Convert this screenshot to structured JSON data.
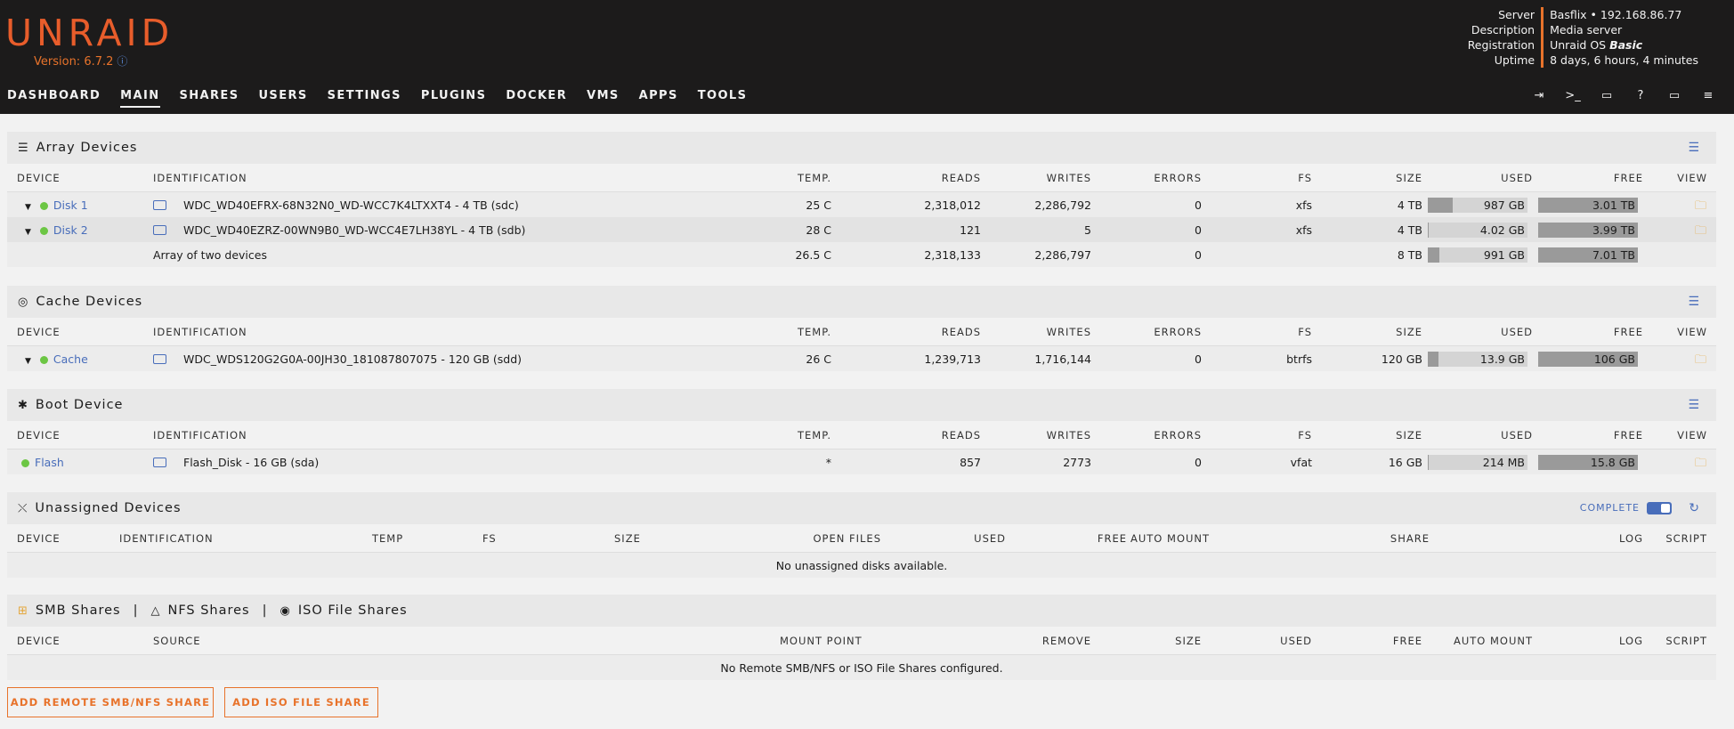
{
  "brand": {
    "logo": "UNRAID",
    "version": "Version: 6.7.2",
    "info_icon": "ⓘ"
  },
  "nav": [
    "DASHBOARD",
    "MAIN",
    "SHARES",
    "USERS",
    "SETTINGS",
    "PLUGINS",
    "DOCKER",
    "VMS",
    "APPS",
    "TOOLS"
  ],
  "server": {
    "labels": [
      "Server",
      "Description",
      "Registration",
      "Uptime"
    ],
    "server": "Basflix • 192.168.86.77",
    "description": "Media server",
    "registration_prefix": "Unraid OS ",
    "registration_tier": "Basic",
    "uptime": "8 days, 6 hours, 4 minutes"
  },
  "tools": [
    "logout-icon",
    "terminal-icon",
    "feedback-icon",
    "help-icon",
    "display-icon",
    "log-icon"
  ],
  "headers": {
    "device": "DEVICE",
    "identification": "IDENTIFICATION",
    "temp": "TEMP.",
    "reads": "READS",
    "writes": "WRITES",
    "errors": "ERRORS",
    "fs": "FS",
    "size": "SIZE",
    "used": "USED",
    "free": "FREE",
    "view": "VIEW"
  },
  "array": {
    "title": "Array Devices",
    "rows": [
      {
        "device": "Disk 1",
        "id": "WDC_WD40EFRX-68N32N0_WD-WCC7K4LTXXT4 - 4 TB (sdc)",
        "temp": "25 C",
        "reads": "2,318,012",
        "writes": "2,286,792",
        "errors": "0",
        "fs": "xfs",
        "size": "4 TB",
        "used": "987 GB",
        "free": "3.01 TB"
      },
      {
        "device": "Disk 2",
        "id": "WDC_WD40EZRZ-00WN9B0_WD-WCC4E7LH38YL - 4 TB (sdb)",
        "temp": "28 C",
        "reads": "121",
        "writes": "5",
        "errors": "0",
        "fs": "xfs",
        "size": "4 TB",
        "used": "4.02 GB",
        "free": "3.99 TB"
      }
    ],
    "total": {
      "id": "Array of two devices",
      "temp": "26.5 C",
      "reads": "2,318,133",
      "writes": "2,286,797",
      "errors": "0",
      "size": "8 TB",
      "used": "991 GB",
      "free": "7.01 TB"
    }
  },
  "cache": {
    "title": "Cache Devices",
    "row": {
      "device": "Cache",
      "id": "WDC_WDS120G2G0A-00JH30_181087807075 - 120 GB (sdd)",
      "temp": "26 C",
      "reads": "1,239,713",
      "writes": "1,716,144",
      "errors": "0",
      "fs": "btrfs",
      "size": "120 GB",
      "used": "13.9 GB",
      "free": "106 GB"
    }
  },
  "boot": {
    "title": "Boot Device",
    "row": {
      "device": "Flash",
      "id": "Flash_Disk - 16 GB (sda)",
      "temp": "*",
      "reads": "857",
      "writes": "2773",
      "errors": "0",
      "fs": "vfat",
      "size": "16 GB",
      "used": "214 MB",
      "free": "15.8 GB"
    }
  },
  "unassigned": {
    "title": "Unassigned Devices",
    "complete": "COMPLETE",
    "headers": [
      "DEVICE",
      "IDENTIFICATION",
      "TEMP",
      "FS",
      "SIZE",
      "OPEN FILES",
      "USED",
      "FREE",
      "AUTO MOUNT",
      "SHARE",
      "LOG",
      "SCRIPT"
    ],
    "empty": "No unassigned disks available."
  },
  "shares": {
    "smb": "SMB Shares",
    "sep": "|",
    "nfs": "NFS Shares",
    "iso": "ISO File Shares",
    "headers": [
      "DEVICE",
      "SOURCE",
      "MOUNT POINT",
      "REMOVE",
      "SIZE",
      "USED",
      "FREE",
      "AUTO MOUNT",
      "LOG",
      "SCRIPT"
    ],
    "empty": "No Remote SMB/NFS or ISO File Shares configured."
  },
  "buttons": {
    "add_smb": "ADD REMOTE SMB/NFS SHARE",
    "add_iso": "ADD ISO FILE SHARE"
  }
}
